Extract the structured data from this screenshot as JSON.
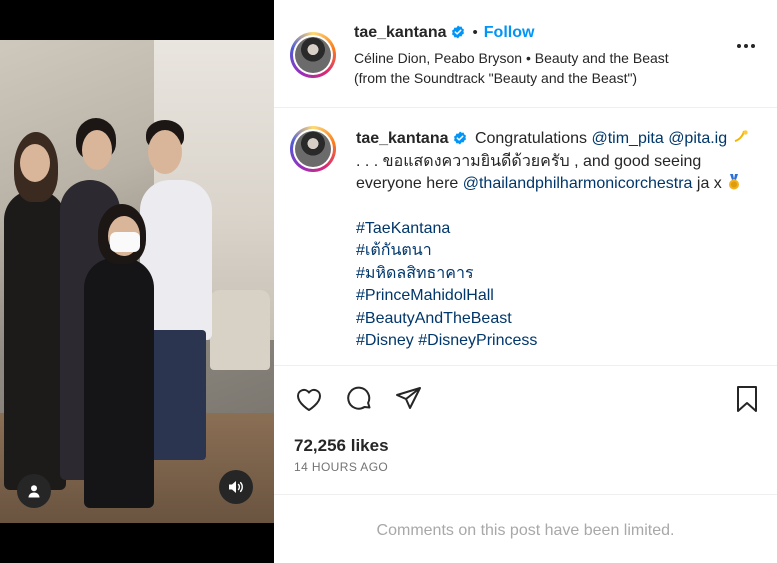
{
  "post": {
    "username": "tae_kantana",
    "separator": "•",
    "follow_label": "Follow",
    "audio_line": "Céline Dion, Peabo Bryson • Beauty and the Beast (from the Soundtrack \"Beauty and the Beast\")"
  },
  "caption": {
    "username": "tae_kantana",
    "text_1": "Congratulations ",
    "mention_1": "@tim_pita",
    "mention_2": "@pita.ig",
    "text_2": " . . . ขอแสดงความยินดีด้วยครับ , and good seeing everyone here ",
    "mention_3": "@thailandphilharmonicorchestra",
    "text_3": " ja x ",
    "hashtags": [
      "#TaeKantana",
      "#เต้กันตนา",
      "#มหิดลสิทธาคาร",
      "#PrinceMahidolHall",
      "#BeautyAndTheBeast",
      "#Disney #DisneyPrincess"
    ]
  },
  "stats": {
    "likes": "72,256 likes",
    "time": "14 HOURS AGO"
  },
  "comments": {
    "limited_text": "Comments on this post have been limited."
  },
  "icons": {
    "verified": "verified-badge-icon",
    "more": "more-options-icon",
    "like": "heart-icon",
    "comment": "comment-icon",
    "share": "share-paper-plane-icon",
    "save": "bookmark-icon",
    "tags": "user-tag-icon",
    "sound": "speaker-icon"
  },
  "colors": {
    "link": "#0095f6",
    "mention": "#00376b",
    "verified": "#0095f6",
    "muted": "#737373",
    "limited": "#a8a8a8"
  }
}
